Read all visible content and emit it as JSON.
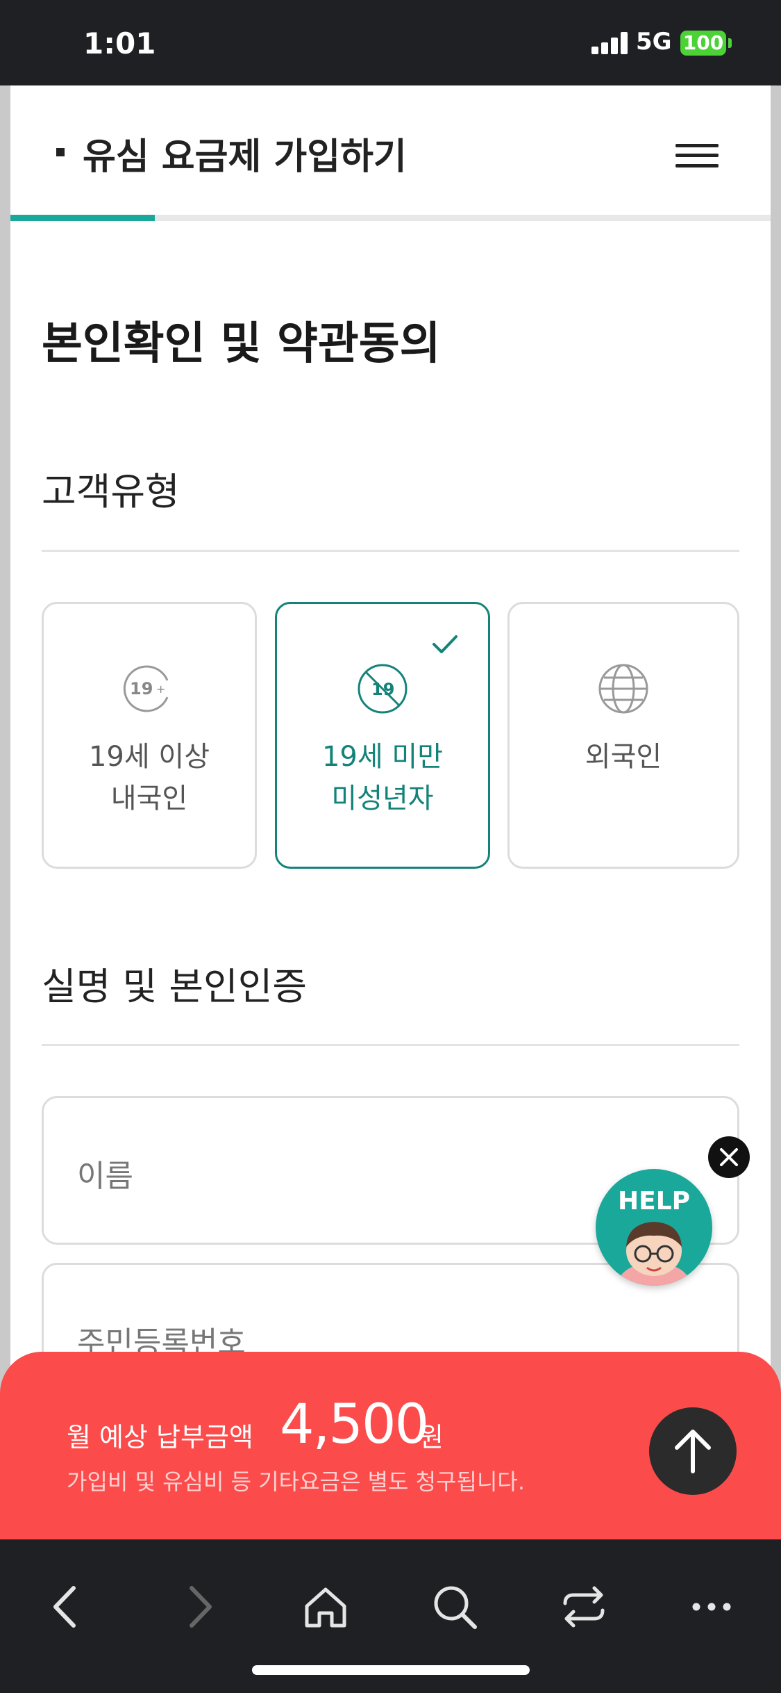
{
  "status_bar": {
    "time": "1:01",
    "network": "5G",
    "battery": "100"
  },
  "header": {
    "title": "유심 요금제 가입하기",
    "progress": 0.19
  },
  "section": {
    "title": "본인확인 및 약관동의"
  },
  "customer_type": {
    "title": "고객유형",
    "options": [
      {
        "icon": "19-plus-icon",
        "line1": "19세 이상",
        "line2": "내국인",
        "selected": false
      },
      {
        "icon": "under-19-icon",
        "line1": "19세 미만",
        "line2": "미성년자",
        "selected": true
      },
      {
        "icon": "globe-icon",
        "line1": "외국인",
        "line2": "",
        "selected": false
      }
    ]
  },
  "verification": {
    "title": "실명 및 본인인증",
    "name_placeholder": "이름",
    "rrn_placeholder": "주민등록번호"
  },
  "help_widget": {
    "label": "HELP"
  },
  "price_bar": {
    "label": "월 예상 납부금액",
    "amount": "4,500",
    "unit": "원",
    "note": "가입비 및 유심비 등 기타요금은 별도 청구됩니다."
  },
  "colors": {
    "accent": "#13837a",
    "progress": "#1aa89a",
    "price_bar": "#fc4b4b"
  }
}
